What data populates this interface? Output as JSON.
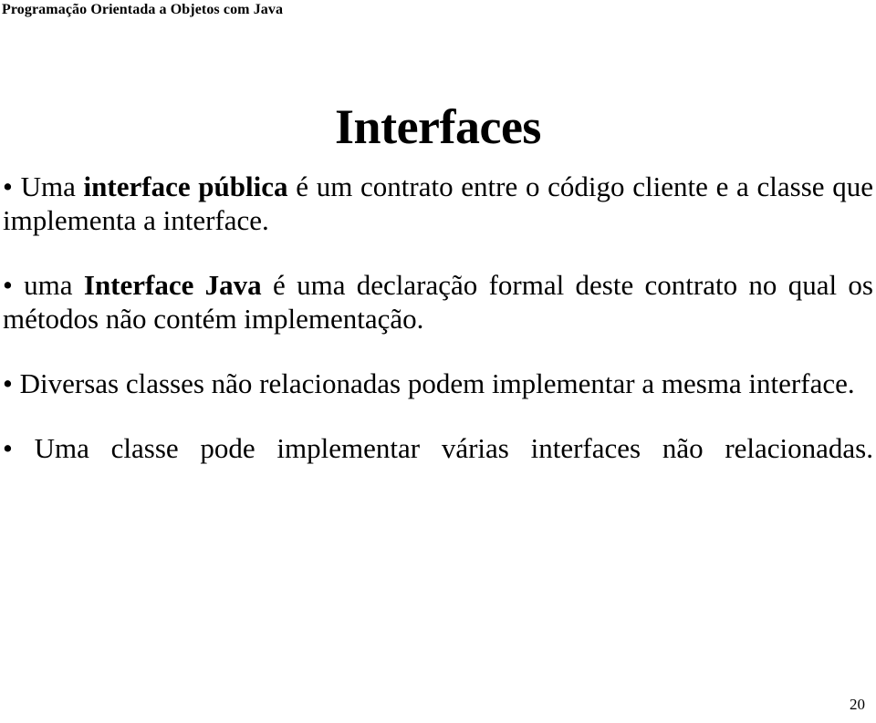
{
  "slide": {
    "header": "Programação Orientada a Objetos com Java",
    "title": "Interfaces",
    "page_number": "20",
    "bullet_marker": "•",
    "bullets": [
      {
        "marker": "•",
        "lead": " Uma ",
        "emphasis": "interface pública",
        "rest": " é um contrato entre o código cliente e a classe que implementa a interface.",
        "full_text": "• Uma interface pública é um contrato entre o código cliente e a classe que implementa a interface."
      },
      {
        "marker": "•",
        "lead": " uma ",
        "emphasis": "Interface Java",
        "rest": " é uma declaração formal deste contrato no qual os métodos não contém implementação.",
        "full_text": "• uma Interface Java é uma declaração formal deste contrato no qual os métodos não contém implementação."
      },
      {
        "marker": "•",
        "lead": " Diversas classes não relacionadas podem implementar a mesma interface.",
        "emphasis": "",
        "rest": "",
        "full_text": "• Diversas classes não relacionadas podem implementar a mesma interface."
      },
      {
        "marker": "•",
        "lead": " Uma classe pode implementar várias interfaces não relacionadas.",
        "emphasis": "",
        "rest": "",
        "full_text": "• Uma classe pode implementar várias interfaces não relacionadas."
      }
    ]
  },
  "colors": {
    "background": "#ffffff",
    "text": "#000000"
  }
}
